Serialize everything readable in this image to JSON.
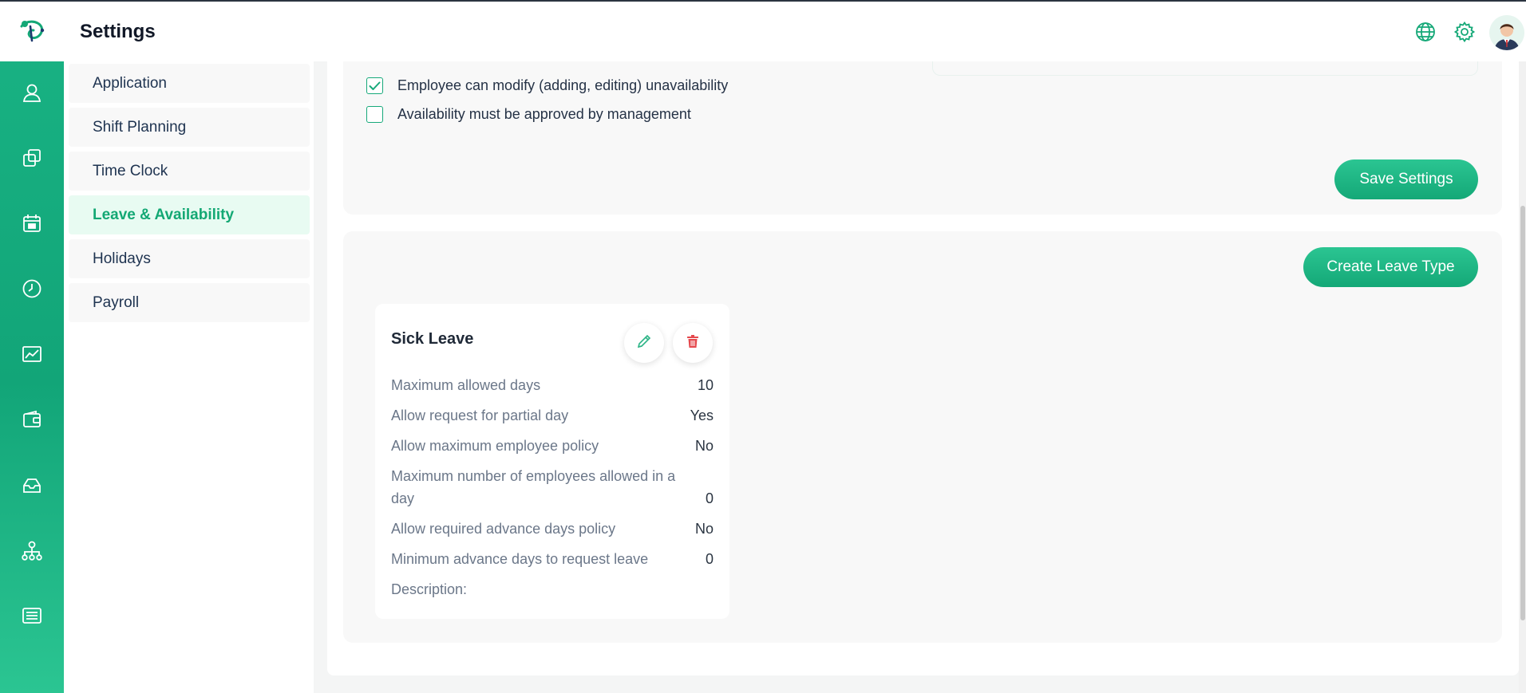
{
  "header": {
    "title": "Settings"
  },
  "icons": {
    "logo": "app-logo-icon",
    "language": "globe-icon",
    "settings": "gear-icon",
    "rail": [
      "user-icon",
      "copy-icon",
      "calendar-icon",
      "clock-icon",
      "chart-icon",
      "wallet-icon",
      "inbox-icon",
      "org-chart-icon",
      "list-icon"
    ]
  },
  "menu": {
    "items": [
      {
        "label": "Application"
      },
      {
        "label": "Shift Planning"
      },
      {
        "label": "Time Clock"
      },
      {
        "label": "Leave & Availability",
        "active": true
      },
      {
        "label": "Holidays"
      },
      {
        "label": "Payroll"
      }
    ]
  },
  "availability": {
    "options": [
      {
        "label": "Employee can modify (adding, editing) unavailability",
        "checked": true
      },
      {
        "label": "Availability must be approved by management",
        "checked": false
      }
    ],
    "save_label": "Save Settings"
  },
  "leave_types": {
    "create_label": "Create Leave Type",
    "cards": [
      {
        "title": "Sick Leave",
        "rows": [
          {
            "key": "Maximum allowed days",
            "value": "10"
          },
          {
            "key": "Allow request for partial day",
            "value": "Yes"
          },
          {
            "key": "Allow maximum employee policy",
            "value": "No"
          },
          {
            "key": "Maximum number of employees allowed in a day",
            "value": "0"
          },
          {
            "key": "Allow required advance days policy",
            "value": "No"
          },
          {
            "key": "Minimum advance days to request leave",
            "value": "0"
          }
        ],
        "description_label": "Description:"
      }
    ]
  },
  "colors": {
    "accent": "#14a877",
    "accent_light": "#e8fbf2",
    "danger": "#e5484d"
  }
}
